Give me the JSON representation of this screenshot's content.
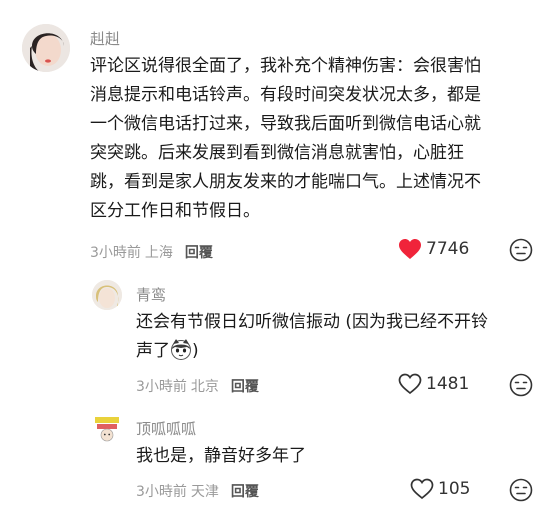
{
  "comments": [
    {
      "username": "赳赳",
      "text_lines": [
        "评论区说得很全面了，我补充个精神伤害：会很害怕",
        "消息提示和电话铃声。有段时间突发状况太多，都是",
        "一个微信电话打过来，导致我后面听到微信电话心就",
        "突突跳。后来发展到看到微信消息就害怕，心脏狂",
        "跳，看到是家人朋友发来的才能喘口气。上述情况不",
        "区分工作日和节假日。"
      ],
      "time": "3小時前",
      "location": "上海",
      "reply_label": "回覆",
      "like_count": "7746",
      "liked": true
    },
    {
      "username": "青鸾",
      "text_lines": [
        "还会有节假日幻听微信振动 (因为我已经不开铃",
        "声了"
      ],
      "text_tail": ")",
      "time": "3小時前",
      "location": "北京",
      "reply_label": "回覆",
      "like_count": "1481",
      "liked": false
    },
    {
      "username": "顶呱呱呱",
      "text_lines": [
        "我也是，静音好多年了"
      ],
      "time": "3小時前",
      "location": "天津",
      "reply_label": "回覆",
      "like_count": "105",
      "liked": false
    }
  ],
  "colors": {
    "like_active": "#f0243a",
    "like_inactive": "#333333",
    "username": "#8a8a8a",
    "meta": "#9a9a9a"
  },
  "icons": {
    "like": "heart-icon",
    "dislike": "neutral-face-icon",
    "emoji": "cat-emoji-icon"
  }
}
